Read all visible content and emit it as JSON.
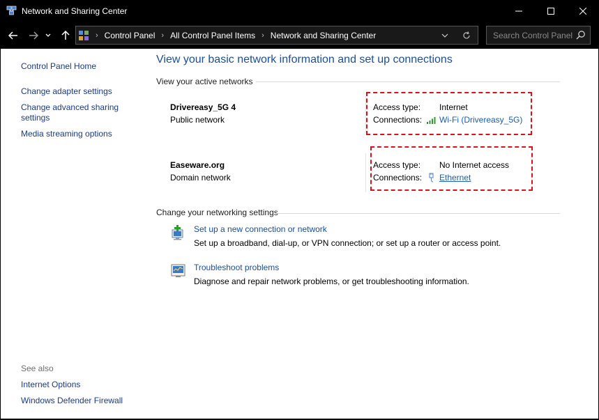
{
  "window": {
    "title": "Network and Sharing Center"
  },
  "address": {
    "crumbs": [
      "Control Panel",
      "All Control Panel Items",
      "Network and Sharing Center"
    ]
  },
  "search": {
    "placeholder": "Search Control Panel"
  },
  "sidebar": {
    "home": "Control Panel Home",
    "links": [
      "Change adapter settings",
      "Change advanced sharing settings",
      "Media streaming options"
    ],
    "see_also_label": "See also",
    "see_also": [
      "Internet Options",
      "Windows Defender Firewall"
    ]
  },
  "main": {
    "title": "View your basic network information and set up connections",
    "active_header": "View your active networks",
    "networks": [
      {
        "name": "Drivereasy_5G 4",
        "category": "Public network",
        "access_label": "Access type:",
        "access_value": "Internet",
        "conn_label": "Connections:",
        "conn_value": "Wi-Fi (Drivereasy_5G)"
      },
      {
        "name": "Easeware.org",
        "category": "Domain network",
        "access_label": "Access type:",
        "access_value": "No Internet access",
        "conn_label": "Connections:",
        "conn_value": "Ethernet"
      }
    ],
    "change_header": "Change your networking settings",
    "tasks": [
      {
        "link": "Set up a new connection or network",
        "desc": "Set up a broadband, dial-up, or VPN connection; or set up a router or access point."
      },
      {
        "link": "Troubleshoot problems",
        "desc": "Diagnose and repair network problems, or get troubleshooting information."
      }
    ]
  },
  "colors": {
    "link": "#1a4fa0",
    "highlight_border": "#e0101a"
  }
}
